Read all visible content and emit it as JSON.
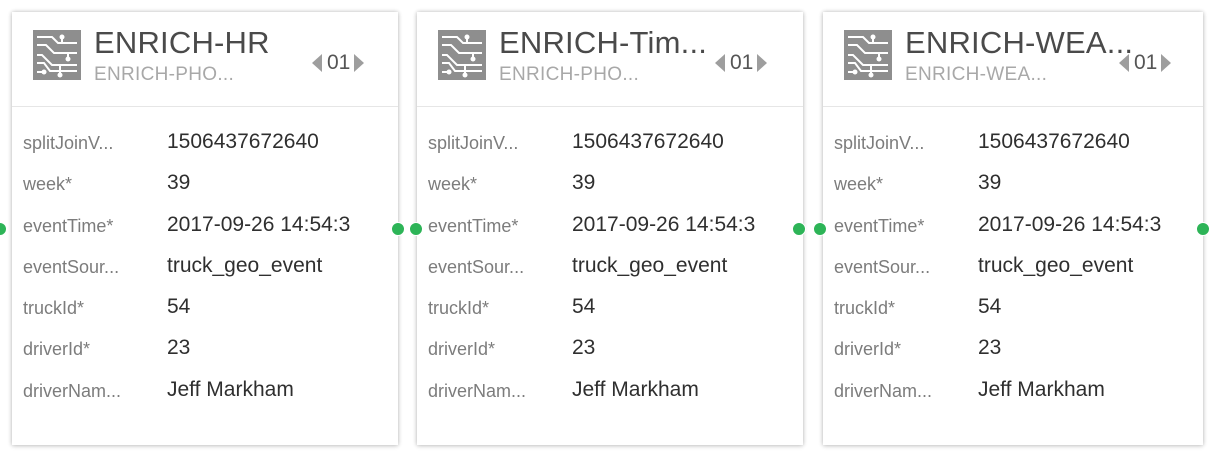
{
  "colors": {
    "port": "#2db457",
    "title": "#4a4a4a",
    "subtitle": "#a8a8a8",
    "field_name": "#7c7c7c",
    "field_value": "#2f2f2f"
  },
  "nodes": [
    {
      "icon": "circuit-board-icon",
      "title": "ENRICH-HR",
      "subtitle": "ENRICH-PHO...",
      "page": "01",
      "fields": [
        {
          "name": "splitJoinV...",
          "value": "1506437672640"
        },
        {
          "name": "week*",
          "value": "39"
        },
        {
          "name": "eventTime*",
          "value": "2017-09-26 14:54:3"
        },
        {
          "name": "eventSour...",
          "value": "truck_geo_event"
        },
        {
          "name": "truckId*",
          "value": "54"
        },
        {
          "name": "driverId*",
          "value": "23"
        },
        {
          "name": "driverNam...",
          "value": "Jeff Markham"
        }
      ]
    },
    {
      "icon": "circuit-board-icon",
      "title": "ENRICH-Tim...",
      "subtitle": "ENRICH-PHO...",
      "page": "01",
      "fields": [
        {
          "name": "splitJoinV...",
          "value": "1506437672640"
        },
        {
          "name": "week*",
          "value": "39"
        },
        {
          "name": "eventTime*",
          "value": "2017-09-26 14:54:3"
        },
        {
          "name": "eventSour...",
          "value": "truck_geo_event"
        },
        {
          "name": "truckId*",
          "value": "54"
        },
        {
          "name": "driverId*",
          "value": "23"
        },
        {
          "name": "driverNam...",
          "value": "Jeff Markham"
        }
      ]
    },
    {
      "icon": "circuit-board-icon",
      "title": "ENRICH-WEA...",
      "subtitle": "ENRICH-WEA...",
      "page": "01",
      "fields": [
        {
          "name": "splitJoinV...",
          "value": "1506437672640"
        },
        {
          "name": "week*",
          "value": "39"
        },
        {
          "name": "eventTime*",
          "value": "2017-09-26 14:54:3"
        },
        {
          "name": "eventSour...",
          "value": "truck_geo_event"
        },
        {
          "name": "truckId*",
          "value": "54"
        },
        {
          "name": "driverId*",
          "value": "23"
        },
        {
          "name": "driverNam...",
          "value": "Jeff Markham"
        }
      ]
    }
  ]
}
